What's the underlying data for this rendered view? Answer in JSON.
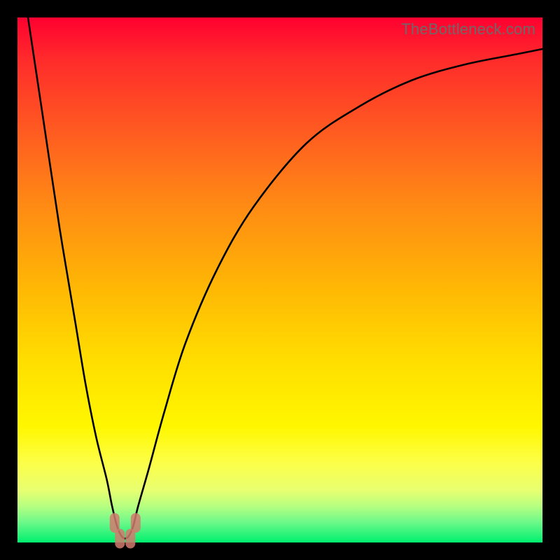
{
  "watermark": "TheBottleneck.com",
  "chart_data": {
    "type": "line",
    "title": "",
    "xlabel": "",
    "ylabel": "",
    "xlim": [
      0,
      100
    ],
    "ylim": [
      0,
      100
    ],
    "grid": false,
    "series": [
      {
        "name": "bottleneck-curve",
        "x": [
          2,
          5,
          8,
          11,
          13,
          15,
          17,
          18,
          19,
          20,
          21,
          22,
          23,
          25,
          28,
          32,
          38,
          45,
          55,
          65,
          75,
          85,
          95,
          100
        ],
        "y": [
          100,
          80,
          60,
          42,
          30,
          20,
          12,
          7,
          3,
          1,
          1,
          3,
          7,
          14,
          25,
          38,
          52,
          64,
          76,
          83,
          88,
          91,
          93,
          94
        ]
      }
    ],
    "legend": false,
    "background_gradient": [
      "#ff0030",
      "#ffdd00",
      "#00f070"
    ],
    "markers": [
      {
        "name": "valley-left-marker",
        "x": 18.5,
        "y": 4
      },
      {
        "name": "valley-bottom-left",
        "x": 19.5,
        "y": 1
      },
      {
        "name": "valley-bottom-right",
        "x": 21.5,
        "y": 1
      },
      {
        "name": "valley-right-marker",
        "x": 22.5,
        "y": 4
      }
    ]
  }
}
